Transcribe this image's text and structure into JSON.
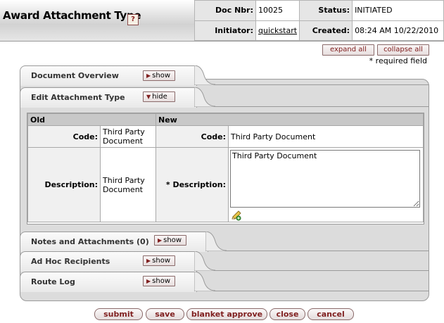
{
  "header": {
    "title": "Award Attachment Type",
    "help_icon": "help-icon",
    "doc_nbr_label": "Doc Nbr:",
    "doc_nbr": "10025",
    "status_label": "Status:",
    "status": "INITIATED",
    "initiator_label": "Initiator:",
    "initiator": "quickstart",
    "created_label": "Created:",
    "created": "08:24 AM 10/22/2010"
  },
  "controls": {
    "expand_all": "expand all",
    "collapse_all": "collapse all",
    "required_note": "* required field"
  },
  "tabs": [
    {
      "title": "Document Overview",
      "toggle": "show"
    },
    {
      "title": "Edit Attachment Type",
      "toggle": "hide"
    },
    {
      "title": "Notes and Attachments (0)",
      "toggle": "show"
    },
    {
      "title": "Ad Hoc Recipients",
      "toggle": "show"
    },
    {
      "title": "Route Log",
      "toggle": "show"
    }
  ],
  "edit": {
    "old_header": "Old",
    "new_header": "New",
    "code_label": "Code:",
    "old_code": "Third Party Document",
    "new_code_label": "Code:",
    "new_code": "Third Party Document",
    "description_label": "Description:",
    "old_description": "Third Party Document",
    "new_description_label": "* Description:",
    "new_description": "Third Party Document"
  },
  "footer": {
    "submit": "submit",
    "save": "save",
    "blanket_approve": "blanket approve",
    "close": "close",
    "cancel": "cancel"
  }
}
